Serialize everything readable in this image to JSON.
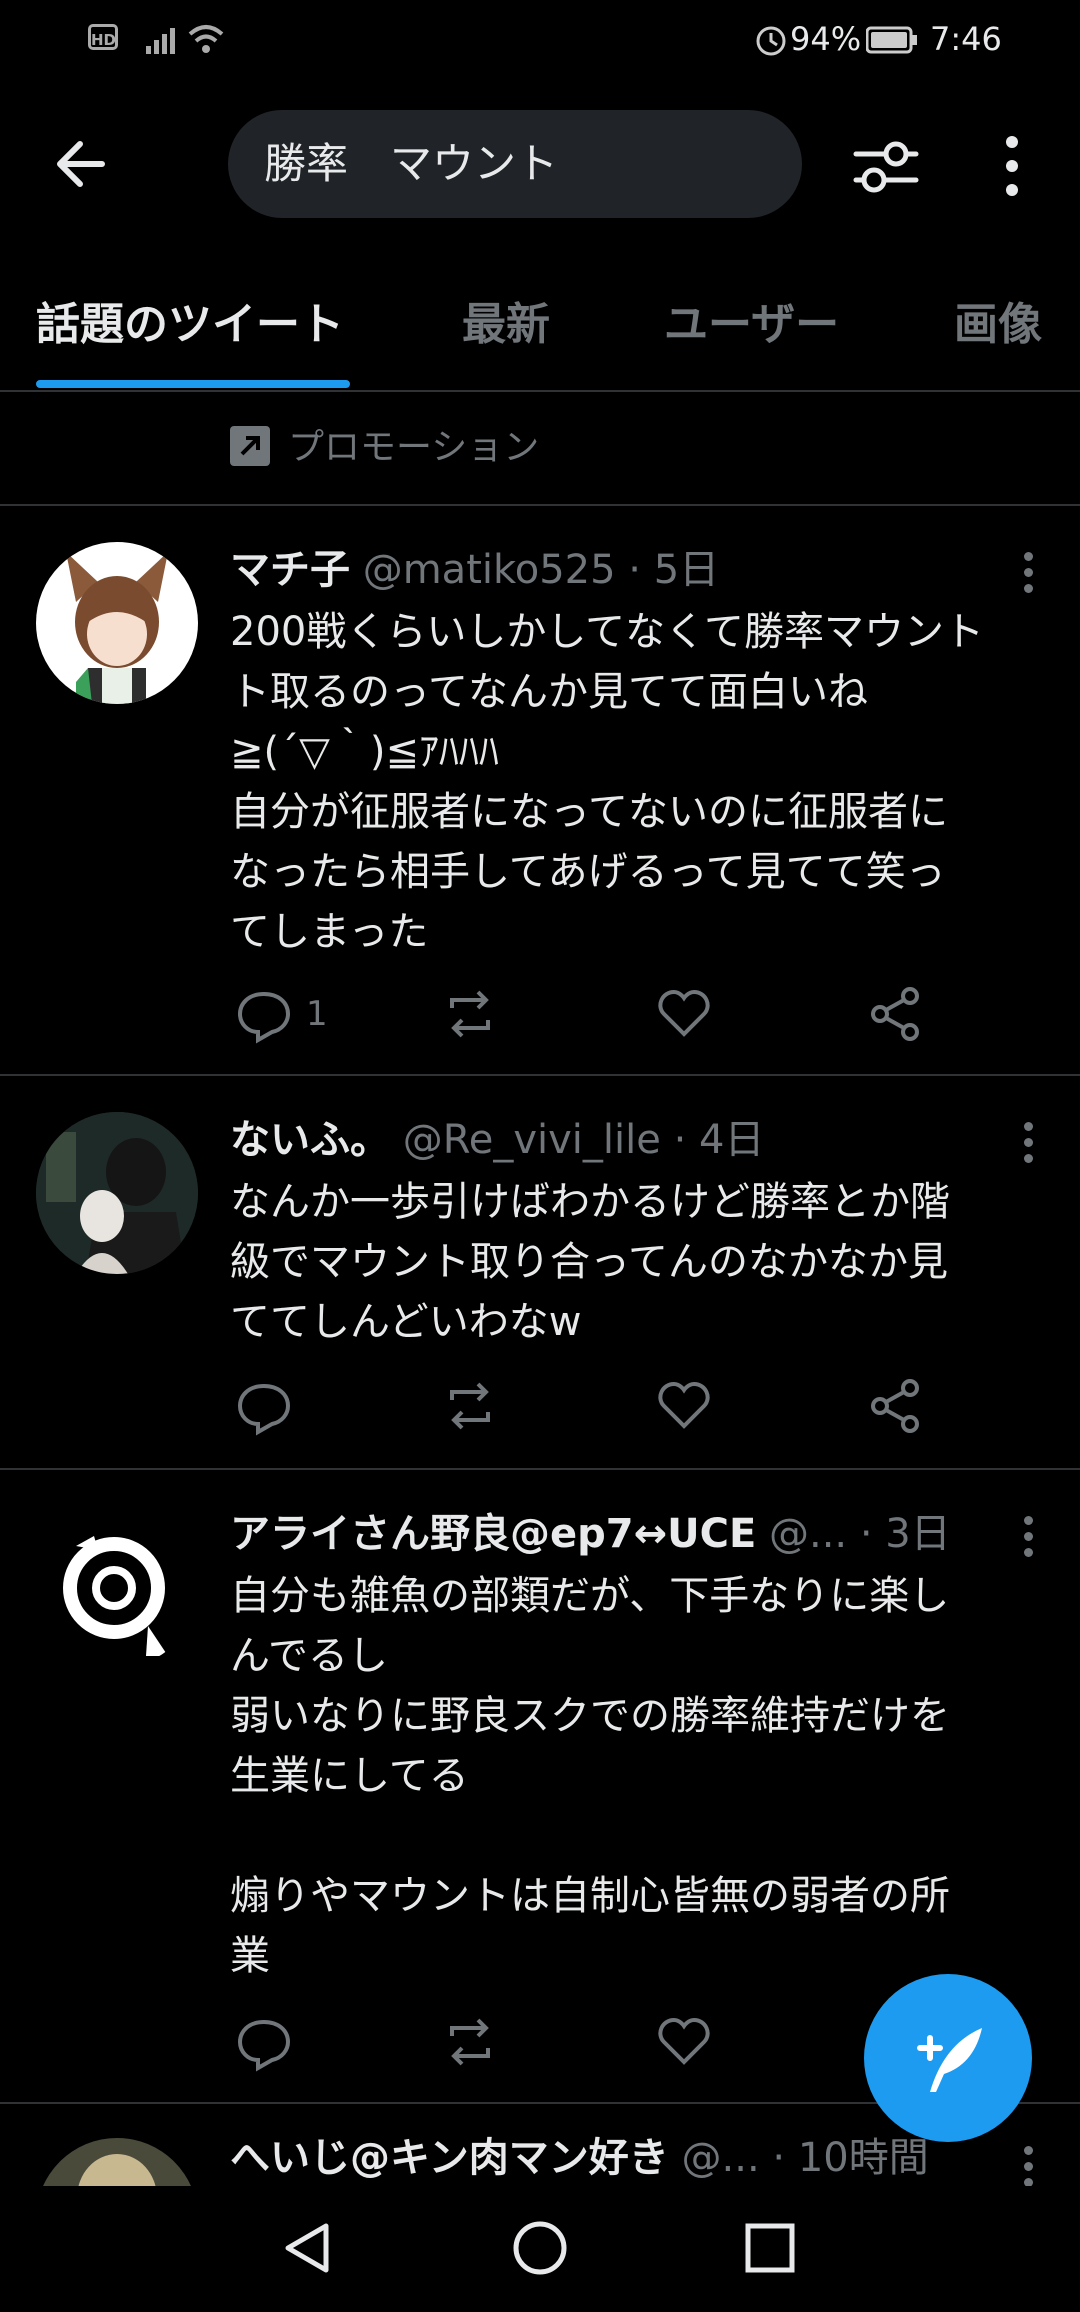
{
  "status_bar": {
    "battery": "94%",
    "time": "7:46",
    "hd": "HD"
  },
  "search": {
    "query": "勝率　マウント"
  },
  "tabs": [
    {
      "label": "話題のツイート",
      "active": true
    },
    {
      "label": "最新",
      "active": false
    },
    {
      "label": "ユーザー",
      "active": false
    },
    {
      "label": "画像",
      "active": false
    }
  ],
  "promotion": {
    "label": "プロモーション"
  },
  "tweets": [
    {
      "name": "マチ子",
      "handle": "@matiko525",
      "time": "· 5日",
      "text": "200戦くらいしかしてなくて勝率マウント\nト取るのってなんか見てて面白いね\n≧(´▽｀)≦ｱﾊﾊﾊ\n自分が征服者になってないのに征服者に\nなったら相手してあげるって見てて笑っ\nてしまった",
      "reply_count": "1"
    },
    {
      "name": "ないふ。",
      "handle": "@Re_vivi_lile",
      "time": "· 4日",
      "text": "なんか一歩引けばわかるけど勝率とか階\n級でマウント取り合ってんのなかなか見\nててしんどいわなw",
      "reply_count": ""
    },
    {
      "name": "アライさん野良@ep7↔UCE",
      "handle": "@...",
      "time": "· 3日",
      "text": "自分も雑魚の部類だが、下手なりに楽し\nんでるし\n弱いなりに野良スクでの勝率維持だけを\n生業にしてる\n\n煽りやマウントは自制心皆無の弱者の所\n業",
      "reply_count": ""
    },
    {
      "name": "へいじ@キン肉マン好き",
      "handle": "@...",
      "time": "· 10時間",
      "text": "",
      "reply_count": ""
    }
  ],
  "colors": {
    "accent": "#1d9bf0",
    "background": "#000000",
    "muted": "#71767b",
    "divider": "#2f3336"
  },
  "icons": [
    "back-arrow-icon",
    "filter-sliders-icon",
    "more-vertical-icon",
    "promoted-icon",
    "reply-icon",
    "retweet-icon",
    "like-icon",
    "share-icon",
    "compose-tweet-icon",
    "nav-back-icon",
    "nav-home-icon",
    "nav-recents-icon"
  ]
}
